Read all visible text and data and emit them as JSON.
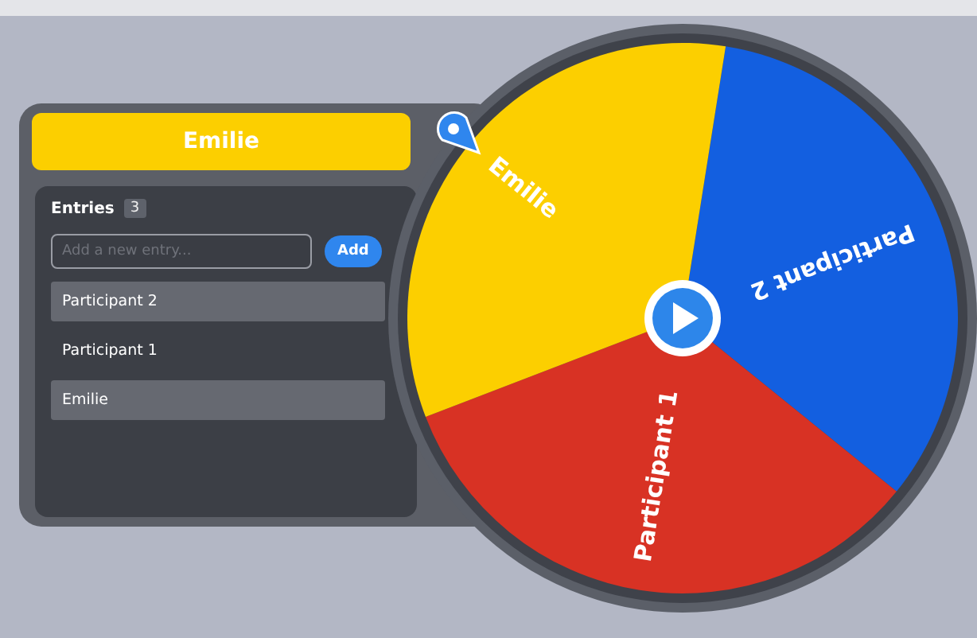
{
  "result_banner": {
    "text": "Emilie",
    "color": "#fccf00"
  },
  "entries": {
    "title": "Entries",
    "count": "3",
    "input": {
      "placeholder": "Add a new entry..."
    },
    "add_button": "Add",
    "items": [
      {
        "label": "Participant 2"
      },
      {
        "label": "Participant 1"
      },
      {
        "label": "Emilie"
      }
    ]
  },
  "wheel": {
    "segments": [
      {
        "label": "Participant 2",
        "color": "#135fe0"
      },
      {
        "label": "Participant 1",
        "color": "#d83224"
      },
      {
        "label": "Emilie",
        "color": "#fccf00"
      }
    ]
  }
}
